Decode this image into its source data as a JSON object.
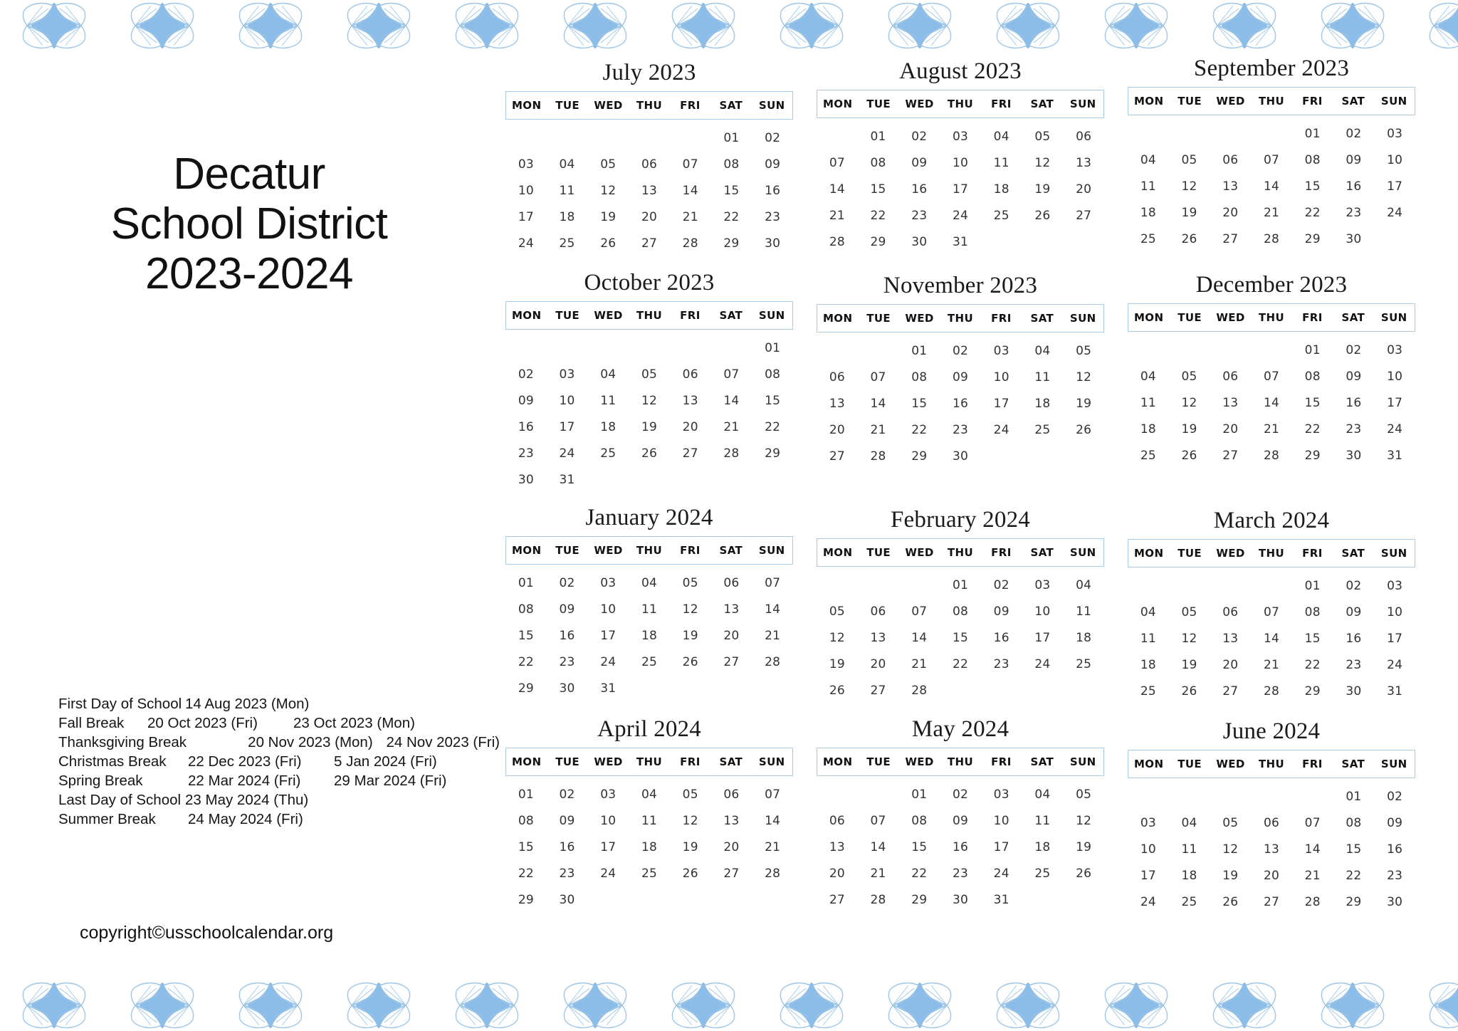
{
  "header": {
    "title_lines": [
      "Decatur",
      "School District",
      "2023-2024"
    ]
  },
  "theme": {
    "accent_blue": "#8cbde8",
    "header_border": "#a9cbe4",
    "text": "#1b1b1b"
  },
  "weekdays": [
    "MON",
    "TUE",
    "WED",
    "THU",
    "FRI",
    "SAT",
    "SUN"
  ],
  "holidays": [
    {
      "name": "First Day of School",
      "start": "14 Aug 2023 (Mon)",
      "end": ""
    },
    {
      "name": "Fall Break",
      "start": "20 Oct 2023 (Fri)",
      "end": "23 Oct 2023 (Mon)"
    },
    {
      "name": "Thanksgiving Break",
      "start": "20 Nov 2023 (Mon)",
      "end": "24 Nov 2023 (Fri)"
    },
    {
      "name": "Christmas Break",
      "start": "22 Dec 2023 (Fri)",
      "end": "5 Jan 2024 (Fri)"
    },
    {
      "name": "Spring Break",
      "start": "22 Mar 2024 (Fri)",
      "end": "29 Mar 2024 (Fri)"
    },
    {
      "name": "Last Day of School",
      "start": "23 May 2024 (Thu)",
      "end": ""
    },
    {
      "name": "Summer Break",
      "start": "24 May 2024 (Fri)",
      "end": ""
    }
  ],
  "copyright": "copyright©usschoolcalendar.org",
  "months": [
    {
      "name": "July 2023",
      "lead_blanks": 5,
      "days": [
        "01",
        "02",
        "03",
        "04",
        "05",
        "06",
        "07",
        "08",
        "09",
        "10",
        "11",
        "12",
        "13",
        "14",
        "15",
        "16",
        "17",
        "18",
        "19",
        "20",
        "21",
        "22",
        "23",
        "24",
        "25",
        "26",
        "27",
        "28",
        "29",
        "30"
      ]
    },
    {
      "name": "August 2023",
      "lead_blanks": 1,
      "days": [
        "01",
        "02",
        "03",
        "04",
        "05",
        "06",
        "07",
        "08",
        "09",
        "10",
        "11",
        "12",
        "13",
        "14",
        "15",
        "16",
        "17",
        "18",
        "19",
        "20",
        "21",
        "22",
        "23",
        "24",
        "25",
        "26",
        "27",
        "28",
        "29",
        "30",
        "31"
      ]
    },
    {
      "name": "September 2023",
      "lead_blanks": 4,
      "days": [
        "01",
        "02",
        "03",
        "04",
        "05",
        "06",
        "07",
        "08",
        "09",
        "10",
        "11",
        "12",
        "13",
        "14",
        "15",
        "16",
        "17",
        "18",
        "19",
        "20",
        "21",
        "22",
        "23",
        "24",
        "25",
        "26",
        "27",
        "28",
        "29",
        "30"
      ]
    },
    {
      "name": "October 2023",
      "lead_blanks": 6,
      "days": [
        "01",
        "02",
        "03",
        "04",
        "05",
        "06",
        "07",
        "08",
        "09",
        "10",
        "11",
        "12",
        "13",
        "14",
        "15",
        "16",
        "17",
        "18",
        "19",
        "20",
        "21",
        "22",
        "23",
        "24",
        "25",
        "26",
        "27",
        "28",
        "29",
        "30",
        "31"
      ]
    },
    {
      "name": "November 2023",
      "lead_blanks": 2,
      "days": [
        "01",
        "02",
        "03",
        "04",
        "05",
        "06",
        "07",
        "08",
        "09",
        "10",
        "11",
        "12",
        "13",
        "14",
        "15",
        "16",
        "17",
        "18",
        "19",
        "20",
        "21",
        "22",
        "23",
        "24",
        "25",
        "26",
        "27",
        "28",
        "29",
        "30"
      ]
    },
    {
      "name": "December 2023",
      "lead_blanks": 4,
      "days": [
        "01",
        "02",
        "03",
        "04",
        "05",
        "06",
        "07",
        "08",
        "09",
        "10",
        "11",
        "12",
        "13",
        "14",
        "15",
        "16",
        "17",
        "18",
        "19",
        "20",
        "21",
        "22",
        "23",
        "24",
        "25",
        "26",
        "27",
        "28",
        "29",
        "30",
        "31"
      ]
    },
    {
      "name": "January 2024",
      "lead_blanks": 0,
      "days": [
        "01",
        "02",
        "03",
        "04",
        "05",
        "06",
        "07",
        "08",
        "09",
        "10",
        "11",
        "12",
        "13",
        "14",
        "15",
        "16",
        "17",
        "18",
        "19",
        "20",
        "21",
        "22",
        "23",
        "24",
        "25",
        "26",
        "27",
        "28",
        "29",
        "30",
        "31"
      ]
    },
    {
      "name": "February 2024",
      "lead_blanks": 3,
      "days": [
        "01",
        "02",
        "03",
        "04",
        "05",
        "06",
        "07",
        "08",
        "09",
        "10",
        "11",
        "12",
        "13",
        "14",
        "15",
        "16",
        "17",
        "18",
        "19",
        "20",
        "21",
        "22",
        "23",
        "24",
        "25",
        "26",
        "27",
        "28"
      ]
    },
    {
      "name": "March 2024",
      "lead_blanks": 4,
      "days": [
        "01",
        "02",
        "03",
        "04",
        "05",
        "06",
        "07",
        "08",
        "09",
        "10",
        "11",
        "12",
        "13",
        "14",
        "15",
        "16",
        "17",
        "18",
        "19",
        "20",
        "21",
        "22",
        "23",
        "24",
        "25",
        "26",
        "27",
        "28",
        "29",
        "30",
        "31"
      ]
    },
    {
      "name": "April 2024",
      "lead_blanks": 0,
      "days": [
        "01",
        "02",
        "03",
        "04",
        "05",
        "06",
        "07",
        "08",
        "09",
        "10",
        "11",
        "12",
        "13",
        "14",
        "15",
        "16",
        "17",
        "18",
        "19",
        "20",
        "21",
        "22",
        "23",
        "24",
        "25",
        "26",
        "27",
        "28",
        "29",
        "30"
      ]
    },
    {
      "name": "May 2024",
      "lead_blanks": 2,
      "days": [
        "01",
        "02",
        "03",
        "04",
        "05",
        "06",
        "07",
        "08",
        "09",
        "10",
        "11",
        "12",
        "13",
        "14",
        "15",
        "16",
        "17",
        "18",
        "19",
        "20",
        "21",
        "22",
        "23",
        "24",
        "25",
        "26",
        "27",
        "28",
        "29",
        "30",
        "31"
      ]
    },
    {
      "name": "June 2024",
      "lead_blanks": 5,
      "days": [
        "01",
        "02",
        "03",
        "04",
        "05",
        "06",
        "07",
        "08",
        "09",
        "10",
        "11",
        "12",
        "13",
        "14",
        "15",
        "16",
        "17",
        "18",
        "19",
        "20",
        "21",
        "22",
        "23",
        "24",
        "25",
        "26",
        "27",
        "28",
        "29",
        "30"
      ]
    }
  ]
}
